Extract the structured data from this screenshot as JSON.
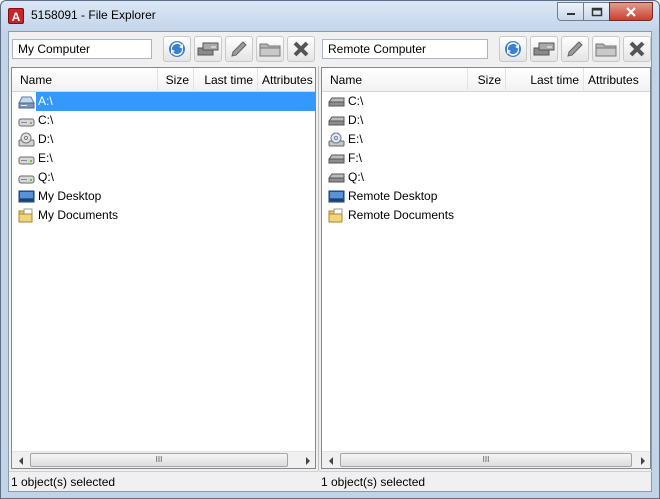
{
  "window": {
    "title": "5158091 - File Explorer",
    "app_icon_letter": "A",
    "accent": "#3399ff"
  },
  "left_pane": {
    "path": "My Computer",
    "columns": [
      "Name",
      "Size",
      "Last time",
      "Attributes"
    ],
    "items": [
      {
        "label": "A:\\",
        "icon": "floppy-drive-icon",
        "selected": true
      },
      {
        "label": "C:\\",
        "icon": "hard-drive-icon"
      },
      {
        "label": "D:\\",
        "icon": "cd-drive-icon"
      },
      {
        "label": "E:\\",
        "icon": "hard-drive-icon"
      },
      {
        "label": "Q:\\",
        "icon": "hard-drive-icon"
      },
      {
        "label": "My Desktop",
        "icon": "desktop-icon"
      },
      {
        "label": "My Documents",
        "icon": "documents-folder-icon"
      }
    ],
    "status": "1 object(s) selected"
  },
  "right_pane": {
    "path": "Remote Computer",
    "columns": [
      "Name",
      "Size",
      "Last time",
      "Attributes"
    ],
    "items": [
      {
        "label": "C:\\",
        "icon": "hard-drive-icon"
      },
      {
        "label": "D:\\",
        "icon": "hard-drive-icon"
      },
      {
        "label": "E:\\",
        "icon": "cd-drive-icon"
      },
      {
        "label": "F:\\",
        "icon": "hard-drive-icon"
      },
      {
        "label": "Q:\\",
        "icon": "hard-drive-icon"
      },
      {
        "label": "Remote Desktop",
        "icon": "desktop-icon"
      },
      {
        "label": "Remote Documents",
        "icon": "documents-folder-icon"
      }
    ],
    "status": "1 object(s) selected"
  },
  "toolbar_icons": [
    "refresh-icon",
    "network-drives-icon",
    "rename-pencil-icon",
    "new-folder-icon",
    "delete-icon"
  ],
  "scrollbar_thumb_grip": "III"
}
